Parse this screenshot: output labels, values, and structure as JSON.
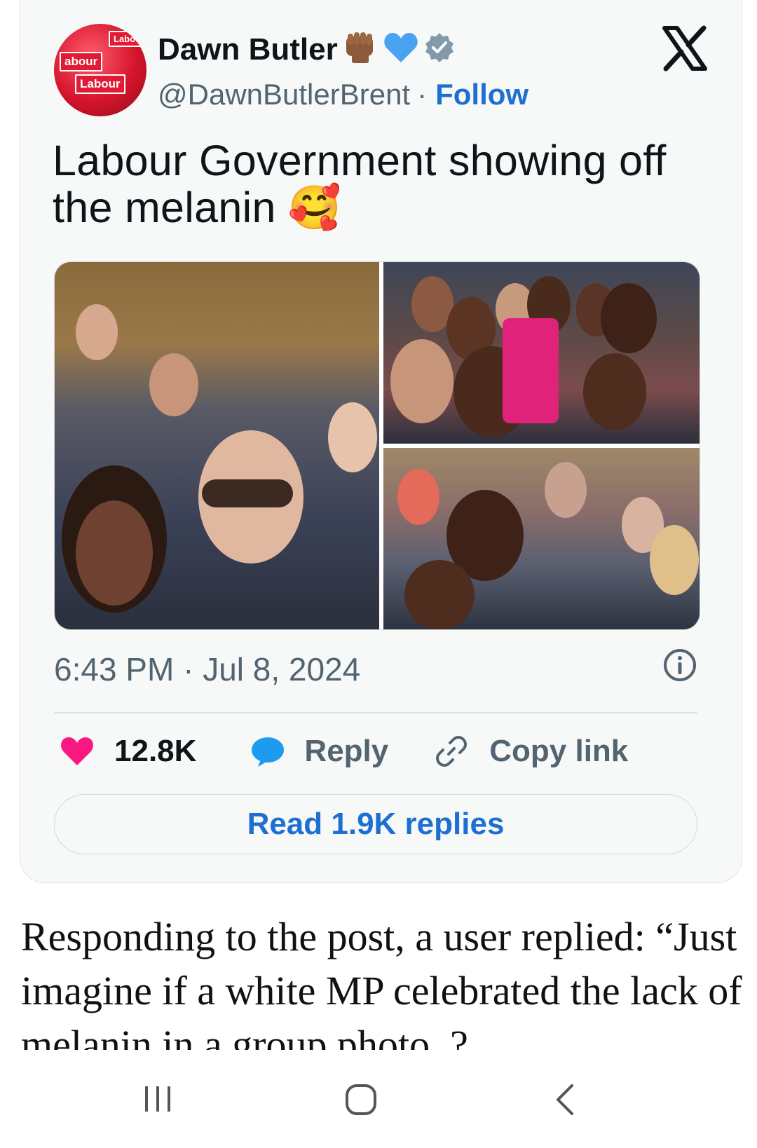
{
  "post": {
    "author_name": "Dawn Butler",
    "emoji_badges": [
      "raised-fist-icon",
      "blue-heart-icon",
      "verified-badge-icon"
    ],
    "handle": "@DawnButlerBrent",
    "separator": "·",
    "follow_label": "Follow",
    "platform_icon": "x-logo-icon",
    "text": "Labour Government showing off the melanin 🥰",
    "time": "6:43 PM · Jul 8, 2024",
    "avatar_sign_text": "Labour"
  },
  "media": {
    "photos": [
      "photo-group-selfie",
      "photo-women-group",
      "photo-man-selfie"
    ]
  },
  "actions": {
    "like_count": "12.8K",
    "reply_label": "Reply",
    "copy_link_label": "Copy link",
    "read_replies_label": "Read 1.9K replies"
  },
  "article": {
    "text": "Responding to the post, a user replied: “Just imagine if a white MP celebrated the lack of melanin in a group photo..?"
  },
  "colors": {
    "accent": "#1d6fd1",
    "like": "#f91880",
    "muted": "#536471"
  },
  "navbar": {
    "buttons": [
      "recent-apps-icon",
      "home-icon",
      "back-icon"
    ]
  }
}
